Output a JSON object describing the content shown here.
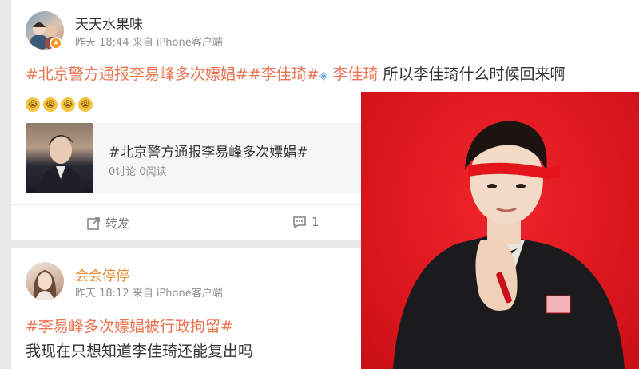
{
  "post1": {
    "username": "天天水果味",
    "meta": "昨天 18:44 来自 iPhone客户端",
    "text": {
      "tag1": "#北京警方通报李易峰多次嫖娼#",
      "tag2": "#李佳琦#",
      "gem_glyph": "◈",
      "tag3": " 李佳琦",
      "body": " 所以李佳琦什么时候回来啊"
    },
    "emoji": [
      "😭",
      "😭",
      "😭",
      "😭"
    ],
    "topic": {
      "title": "#北京警方通报李易峰多次嫖娼#",
      "stats": "0讨论 0阅读"
    },
    "actions": {
      "repost": "转发",
      "comment_count": "1"
    }
  },
  "post2": {
    "username": "会会停停",
    "meta": "昨天 18:12 来自 iPhone客户端",
    "tag": "#李易峰多次嫖娼被行政拘留#",
    "body": "我现在只想知道李佳琦还能复出吗"
  },
  "colors": {
    "tag": "#eb7350",
    "photo_background": "#d9151c",
    "username_highlight": "#e8862a"
  }
}
